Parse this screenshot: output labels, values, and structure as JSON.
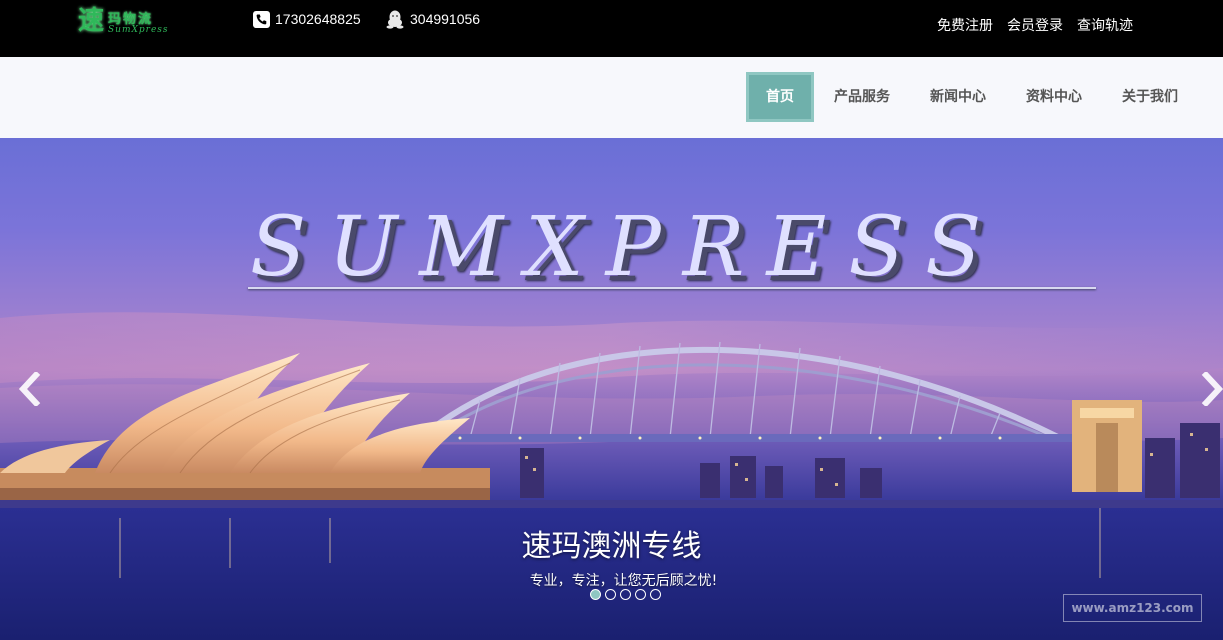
{
  "header": {
    "logo": {
      "big_char": "速",
      "small_chars": "玛物流",
      "latin": "SumXpress"
    },
    "phone": "17302648825",
    "qq": "304991056",
    "links": [
      "免费注册",
      "会员登录",
      "查询轨迹"
    ]
  },
  "nav": {
    "items": [
      "首页",
      "产品服务",
      "新闻中心",
      "资料中心",
      "关于我们"
    ],
    "active_index": 0,
    "active_color": "#6fb0ab"
  },
  "hero": {
    "brand": "SUMXPRESS",
    "title": "速玛澳洲专线",
    "subtitle": "专业，专注，让您无后顾之忧!",
    "slide_count": 5,
    "active_slide": 0,
    "watermark": "www.amz123.com"
  }
}
